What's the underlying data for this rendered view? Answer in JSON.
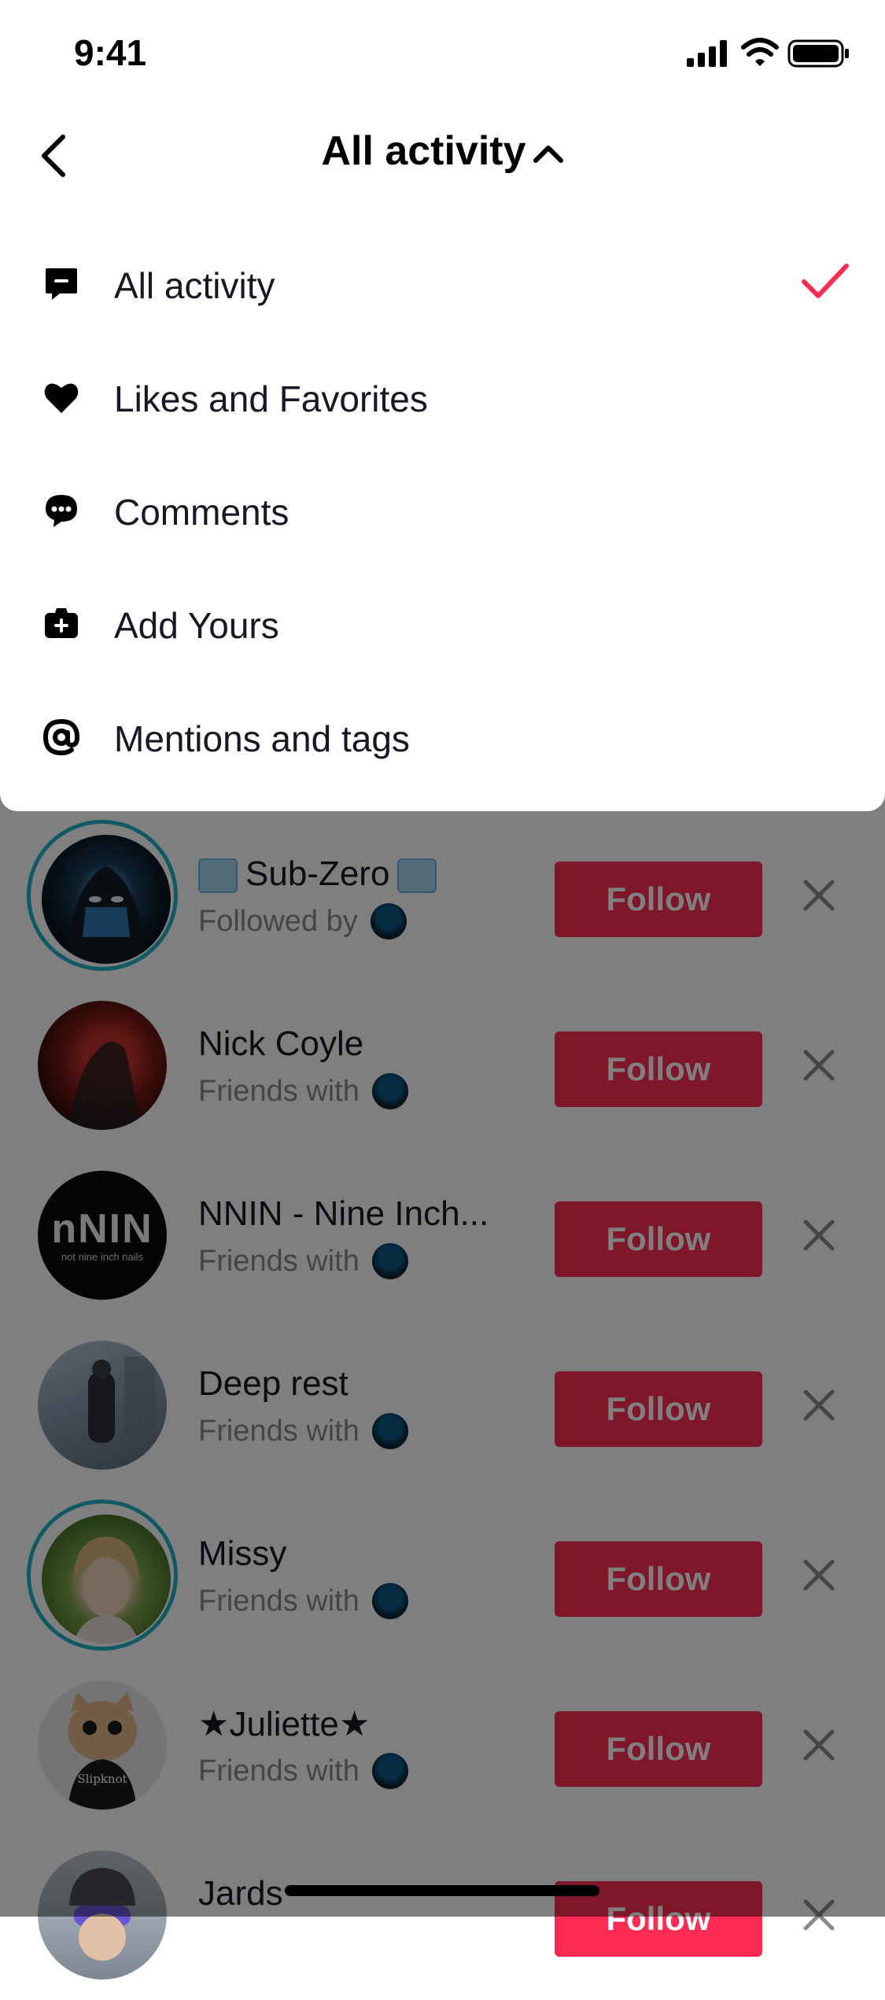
{
  "status_bar": {
    "time": "9:41"
  },
  "header": {
    "title": "All activity"
  },
  "menu": {
    "items": [
      {
        "label": "All activity",
        "icon": "message-square-icon",
        "selected": true
      },
      {
        "label": "Likes and Favorites",
        "icon": "heart-icon",
        "selected": false
      },
      {
        "label": "Comments",
        "icon": "comment-bubble-icon",
        "selected": false
      },
      {
        "label": "Add Yours",
        "icon": "add-yours-icon",
        "selected": false
      },
      {
        "label": "Mentions and tags",
        "icon": "at-sign-icon",
        "selected": false
      }
    ],
    "check_color": "#fe2c55"
  },
  "suggestions": [
    {
      "name": "Sub-Zero",
      "subtitle": "Followed by",
      "button": "Follow",
      "ring": true,
      "name_has_ice_emoji": true
    },
    {
      "name": "Nick Coyle",
      "subtitle": "Friends with",
      "button": "Follow",
      "ring": false
    },
    {
      "name": "NNIN - Nine Inch...",
      "subtitle": "Friends with",
      "button": "Follow",
      "ring": false,
      "logo_text": "nNIN",
      "logo_subtext": "not nine inch nails"
    },
    {
      "name": "Deep rest",
      "subtitle": "Friends with",
      "button": "Follow",
      "ring": false
    },
    {
      "name": "Missy",
      "subtitle": "Friends with",
      "button": "Follow",
      "ring": true
    },
    {
      "name": "★Juliette★",
      "subtitle": "Friends with",
      "button": "Follow",
      "ring": false,
      "shirt_text": "Slipknot"
    },
    {
      "name": "Jards",
      "subtitle": "",
      "button": "Follow",
      "ring": false
    }
  ],
  "colors": {
    "accent": "#fe2c55",
    "ring": "#1fb3c7",
    "dim": "rgba(0,0,0,0.5)"
  }
}
